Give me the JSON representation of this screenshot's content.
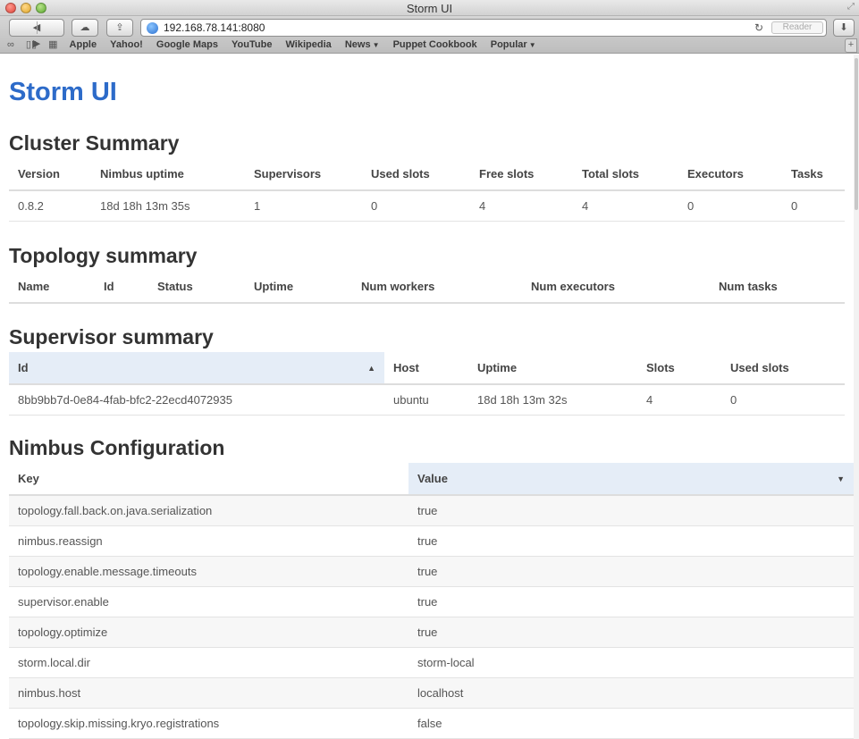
{
  "window": {
    "title": "Storm UI"
  },
  "toolbar": {
    "back_label": "◀",
    "forward_label": "▶",
    "url": "192.168.78.141:8080",
    "reader_label": "Reader"
  },
  "bookmarks": [
    {
      "label": "Apple"
    },
    {
      "label": "Yahoo!"
    },
    {
      "label": "Google Maps"
    },
    {
      "label": "YouTube"
    },
    {
      "label": "Wikipedia"
    },
    {
      "label": "News"
    },
    {
      "label": "Puppet Cookbook"
    },
    {
      "label": "Popular"
    }
  ],
  "page": {
    "title": "Storm UI",
    "cluster": {
      "heading": "Cluster Summary",
      "headers": [
        "Version",
        "Nimbus uptime",
        "Supervisors",
        "Used slots",
        "Free slots",
        "Total slots",
        "Executors",
        "Tasks"
      ],
      "row": [
        "0.8.2",
        "18d 18h 13m 35s",
        "1",
        "0",
        "4",
        "4",
        "0",
        "0"
      ]
    },
    "topology": {
      "heading": "Topology summary",
      "headers": [
        "Name",
        "Id",
        "Status",
        "Uptime",
        "Num workers",
        "Num executors",
        "Num tasks"
      ]
    },
    "supervisor": {
      "heading": "Supervisor summary",
      "headers": [
        "Id",
        "Host",
        "Uptime",
        "Slots",
        "Used slots"
      ],
      "row": [
        "8bb9bb7d-0e84-4fab-bfc2-22ecd4072935",
        "ubuntu",
        "18d 18h 13m 32s",
        "4",
        "0"
      ]
    },
    "nimbus": {
      "heading": "Nimbus Configuration",
      "headers": [
        "Key",
        "Value"
      ],
      "rows": [
        [
          "topology.fall.back.on.java.serialization",
          "true"
        ],
        [
          "nimbus.reassign",
          "true"
        ],
        [
          "topology.enable.message.timeouts",
          "true"
        ],
        [
          "supervisor.enable",
          "true"
        ],
        [
          "topology.optimize",
          "true"
        ],
        [
          "storm.local.dir",
          "storm-local"
        ],
        [
          "nimbus.host",
          "localhost"
        ],
        [
          "topology.skip.missing.kryo.registrations",
          "false"
        ]
      ]
    }
  },
  "colors": {
    "title_blue": "#2d6bc9",
    "sorted_header_bg": "#e5edf7"
  }
}
